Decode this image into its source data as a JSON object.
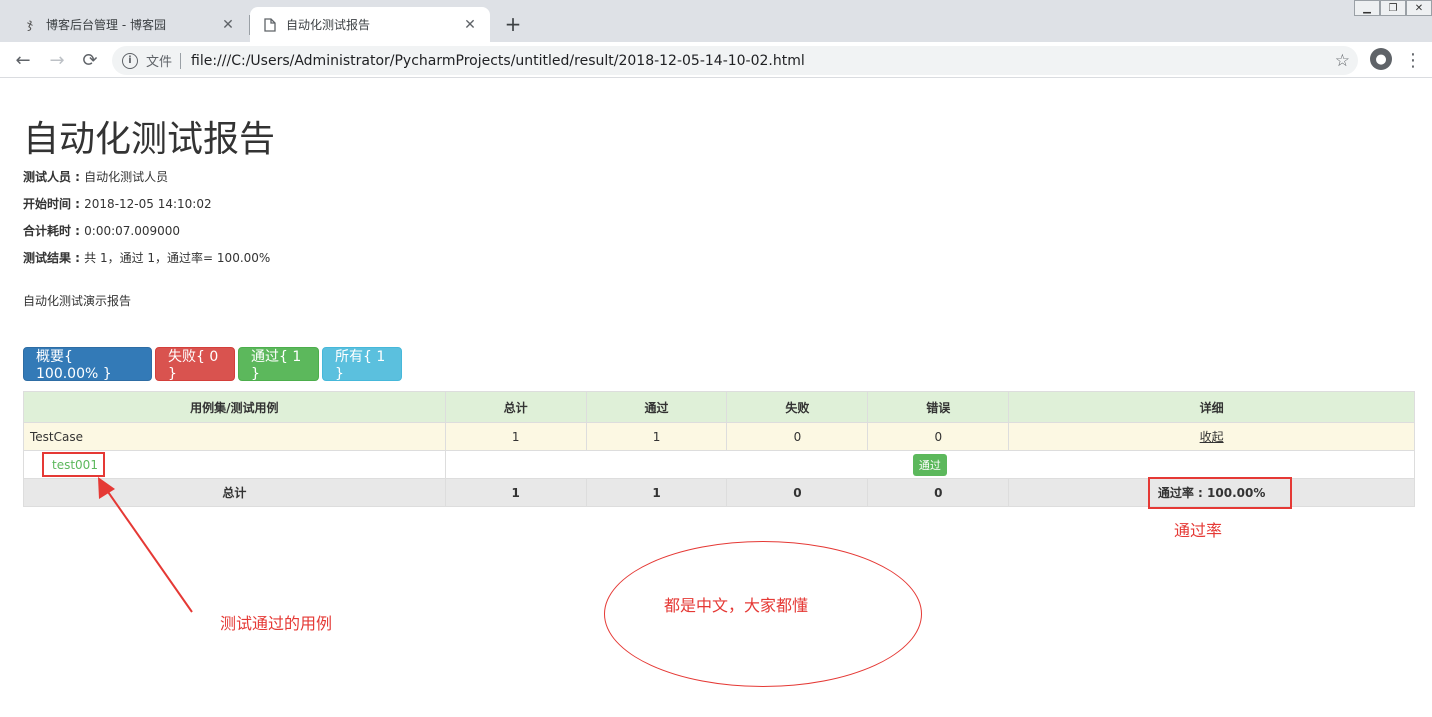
{
  "browser": {
    "tabs": [
      {
        "title": "博客后台管理 - 博客园",
        "icon": "cnblogs-icon",
        "active": false
      },
      {
        "title": "自动化测试报告",
        "icon": "document-icon",
        "active": true
      }
    ],
    "address_scheme_label": "文件",
    "url": "file:///C:/Users/Administrator/PycharmProjects/untitled/result/2018-12-05-14-10-02.html"
  },
  "report": {
    "title": "自动化测试报告",
    "attributes": [
      {
        "label": "测试人员 : ",
        "value": "自动化测试人员"
      },
      {
        "label": "开始时间 : ",
        "value": "2018-12-05 14:10:02"
      },
      {
        "label": "合计耗时 : ",
        "value": "0:00:07.009000"
      },
      {
        "label": "测试结果 : ",
        "value": "共 1，通过 1，通过率= 100.00%"
      }
    ],
    "description": "自动化测试演示报告"
  },
  "filters": {
    "summary": "概要{ 100.00% }",
    "failed": "失败{ 0 }",
    "passed": "通过{ 1 }",
    "all": "所有{ 1 }"
  },
  "table": {
    "headers": [
      "用例集/测试用例",
      "总计",
      "通过",
      "失败",
      "错误",
      "详细"
    ],
    "suite": {
      "name": "TestCase",
      "total": "1",
      "pass": "1",
      "fail": "0",
      "error": "0",
      "detail": "收起"
    },
    "case": {
      "name": "test001",
      "status": "通过"
    },
    "totals": {
      "label": "总计",
      "total": "1",
      "pass": "1",
      "fail": "0",
      "error": "0",
      "rate": "通过率 : 100.00%"
    }
  },
  "annotations": {
    "rate_note": "通过率",
    "case_note": "测试通过的用例",
    "ellipse_note": "都是中文，大家都懂",
    "color": "#e53935"
  }
}
